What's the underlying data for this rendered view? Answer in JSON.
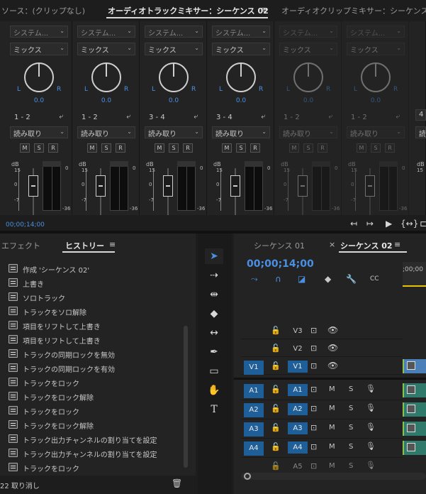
{
  "tabs": {
    "source": "ソース：(クリップなし)",
    "track_mixer": "オーディオトラックミキサー：シーケンス 02",
    "clip_mixer": "オーディオクリップミキサー：シーケンス",
    "menu_icon": "≡"
  },
  "mixer": {
    "strips": [
      {
        "assign": "システム...",
        "mode": "ミックス",
        "pan": "0.0",
        "channel": "1 - 2",
        "automation": "読み取り",
        "enabled": true
      },
      {
        "assign": "システム...",
        "mode": "ミックス",
        "pan": "0.0",
        "channel": "1 - 2",
        "automation": "読み取り",
        "enabled": true
      },
      {
        "assign": "システム...",
        "mode": "ミックス",
        "pan": "0.0",
        "channel": "3 - 4",
        "automation": "読み取り",
        "enabled": true
      },
      {
        "assign": "システム...",
        "mode": "ミックス",
        "pan": "0.0",
        "channel": "3 - 4",
        "automation": "読み取り",
        "enabled": true
      },
      {
        "assign": "システム...",
        "mode": "ミックス",
        "pan": "0.0",
        "channel": "1 - 2",
        "automation": "読み取り",
        "enabled": false
      },
      {
        "assign": "システム...",
        "mode": "ミックス",
        "pan": "0.0",
        "channel": "1 - 2",
        "automation": "読み取り",
        "enabled": false
      }
    ],
    "labels": {
      "L": "L",
      "R": "R",
      "M": "M",
      "S": "S",
      "Rbtn": "R",
      "dB": "dB",
      "s15": "15",
      "s0": "0",
      "s7": "-7",
      "m0": "0",
      "m36": "-36"
    },
    "partial": {
      "channel": "4",
      "automation": "読",
      "dB": "dB",
      "s15": "15"
    },
    "timecode": "00;00;14;00",
    "controls": [
      "↤",
      "↦",
      "▶",
      "{↔}",
      "⊏"
    ]
  },
  "history": {
    "tab_effects": "エフェクト",
    "tab_history": "ヒストリー",
    "menu_icon": "≡",
    "items": [
      "作成 'シーケンス 02'",
      "上書き",
      "ソロトラック",
      "トラックをソロ解除",
      "項目をリフトして上書き",
      "項目をリフトして上書き",
      "トラックの同期ロックを無効",
      "トラックの同期ロックを有効",
      "トラックをロック",
      "トラックをロック解除",
      "トラックをロック",
      "トラックをロック解除",
      "トラック出力チャンネルの割り当てを設定",
      "トラック出力チャンネルの割り当てを設定",
      "トラックをロック"
    ],
    "footer": "22 取り消し"
  },
  "timeline": {
    "tab1": "シーケンス 01",
    "tab2": "シーケンス 02",
    "close": "×",
    "menu_icon": "≡",
    "timecode": "00;00;14;00",
    "ruler_label": ";00;00",
    "video_tracks": [
      {
        "src": "",
        "name": "V3",
        "src_on": false,
        "name_on": false
      },
      {
        "src": "",
        "name": "V2",
        "src_on": false,
        "name_on": false
      },
      {
        "src": "V1",
        "name": "V1",
        "src_on": true,
        "name_on": true
      }
    ],
    "audio_tracks": [
      {
        "src": "A1",
        "name": "A1",
        "M": "M",
        "S": "S"
      },
      {
        "src": "A2",
        "name": "A2",
        "M": "M",
        "S": "S"
      },
      {
        "src": "A3",
        "name": "A3",
        "M": "M",
        "S": "S"
      },
      {
        "src": "A4",
        "name": "A4",
        "M": "M",
        "S": "S"
      },
      {
        "src": "",
        "name": "A5",
        "M": "M",
        "S": "S"
      }
    ]
  }
}
